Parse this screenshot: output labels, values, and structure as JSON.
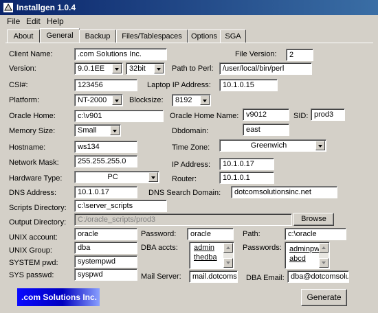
{
  "window": {
    "title": "Installgen 1.0.4"
  },
  "menu": {
    "file": "File",
    "edit": "Edit",
    "help": "Help"
  },
  "tabs": [
    "About",
    "General",
    "Backup",
    "Files/Tablespaces",
    "Options",
    "SGA"
  ],
  "form": {
    "client_name": {
      "label": "Client Name:",
      "value": ".com Solutions Inc."
    },
    "file_version": {
      "label": "File Version:",
      "value": "2"
    },
    "version": {
      "label": "Version:",
      "value": "9.0.1EE",
      "bits": "32bit"
    },
    "path_to_perl": {
      "label": "Path to Perl:",
      "value": "/user/local/bin/perl"
    },
    "csi": {
      "label": "CSI#:",
      "value": "123456"
    },
    "laptop_ip": {
      "label": "Laptop IP Address:",
      "value": "10.1.0.15"
    },
    "platform": {
      "label": "Platform:",
      "value": "NT-2000"
    },
    "blocksize": {
      "label": "Blocksize:",
      "value": "8192"
    },
    "oracle_home": {
      "label": "Oracle Home:",
      "value": "c:\\v901"
    },
    "oracle_home_name": {
      "label": "Oracle Home Name:",
      "value": "v9012"
    },
    "sid": {
      "label": "SID:",
      "value": "prod3"
    },
    "memory_size": {
      "label": "Memory Size:",
      "value": "Small"
    },
    "dbdomain": {
      "label": "Dbdomain:",
      "value": "east"
    },
    "hostname": {
      "label": "Hostname:",
      "value": "ws134"
    },
    "time_zone": {
      "label": "Time Zone:",
      "value": "Greenwich"
    },
    "network_mask": {
      "label": "Network Mask:",
      "value": "255.255.255.0"
    },
    "ip_address": {
      "label": "IP Address:",
      "value": "10.1.0.17"
    },
    "hardware_type": {
      "label": "Hardware Type:",
      "value": "PC"
    },
    "router": {
      "label": "Router:",
      "value": "10.1.0.1"
    },
    "dns_address": {
      "label": "DNS Address:",
      "value": "10.1.0.17"
    },
    "dns_search_domain": {
      "label": "DNS Search Domain:",
      "value": "dotcomsolutionsinc.net"
    },
    "scripts_directory": {
      "label": "Scripts Directory:",
      "value": "c:\\server_scripts"
    },
    "output_directory": {
      "label": "Output Directory:",
      "value": "C:/oracle_scripts/prod3"
    },
    "browse_button": "Browse",
    "unix_account": {
      "label": "UNIX account:",
      "value": "oracle"
    },
    "password": {
      "label": "Password:",
      "value": "oracle"
    },
    "path": {
      "label": "Path:",
      "value": "c:\\oracle"
    },
    "unix_group": {
      "label": "UNIX Group:",
      "value": "dba"
    },
    "dba_accts": {
      "label": "DBA accts:",
      "items": [
        "admin",
        "thedba"
      ]
    },
    "passwords": {
      "label": "Passwords:",
      "items": [
        "adminpw",
        "abcd"
      ]
    },
    "system_pwd": {
      "label": "SYSTEM pwd:",
      "value": "systempwd"
    },
    "sys_passwd": {
      "label": "SYS passwd:",
      "value": "syspwd"
    },
    "mail_server": {
      "label": "Mail Server:",
      "value": "mail.dotcoms"
    },
    "dba_email": {
      "label": "DBA Email:",
      "value": "dba@dotcomsolu"
    }
  },
  "logo_text": ".com Solutions Inc.",
  "generate_button": "Generate"
}
